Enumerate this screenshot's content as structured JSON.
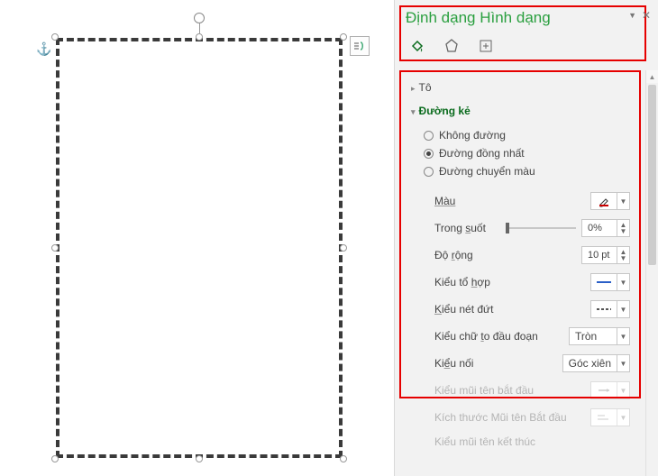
{
  "panel": {
    "title": "Định dạng Hình dạng",
    "modes": {
      "fill": "fill-effects",
      "shape": "shape-effects",
      "size": "size-layout"
    }
  },
  "sections": {
    "fill": "Tô",
    "line": "Đường kẻ"
  },
  "line_options": {
    "none": "Không đường",
    "solid": "Đường đồng nhất",
    "gradient": "Đường chuyển màu"
  },
  "props": {
    "color": {
      "label": "Màu"
    },
    "transparency": {
      "label": "Trong suốt",
      "value": "0%"
    },
    "width": {
      "label": "Độ rộng",
      "value": "10 pt"
    },
    "compound": {
      "label": "Kiểu tổ hợp"
    },
    "dash": {
      "label": "Kiểu nét đứt"
    },
    "cap": {
      "label": "Kiểu chữ to đầu đoạn",
      "value": "Tròn"
    },
    "join": {
      "label": "Kiểu nối",
      "value": "Góc xiên"
    },
    "arrow_begin": {
      "label": "Kiểu mũi tên bắt đầu"
    },
    "arrow_begin_size": {
      "label": "Kích thước Mũi tên Bắt đầu"
    },
    "arrow_end": {
      "label": "Kiểu mũi tên kết thúc"
    }
  }
}
